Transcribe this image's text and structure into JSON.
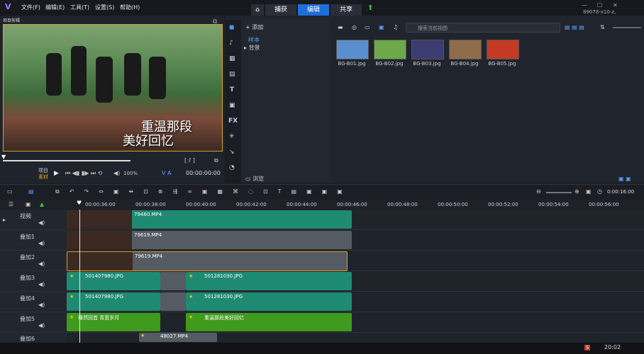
{
  "app": {
    "logo": "V",
    "status": "89078-x10-z, 1920*1080"
  },
  "menu": [
    "文件(F)",
    "编辑(E)",
    "工具(T)",
    "设置(S)",
    "帮助(H)"
  ],
  "tabs": [
    {
      "label": "⌂"
    },
    {
      "label": "捕获"
    },
    {
      "label": "编辑"
    },
    {
      "label": "共享"
    }
  ],
  "preview": {
    "corner_label": "项目剪辑",
    "caption_line1": "重温那段",
    "caption_line2": "美好回忆",
    "mode_project": "项目",
    "mode_clip": "素材",
    "timecode": "00:00:00:00",
    "zoom": "100%"
  },
  "library": {
    "add_label": "添加",
    "tree": [
      "样本",
      "背景"
    ],
    "search_placeholder": "搜索当前视图",
    "browse_label": "浏览",
    "thumbs": [
      {
        "name": "BG-B01.jpg",
        "color": "#5a8fcf"
      },
      {
        "name": "BG-B02.jpg",
        "color": "#6da94a"
      },
      {
        "name": "BG-B03.jpg",
        "color": "#3b3d70"
      },
      {
        "name": "BG-B04.jpg",
        "color": "#8f6d4b"
      },
      {
        "name": "BG-B05.jpg",
        "color": "#c43a24"
      }
    ]
  },
  "timeline": {
    "ruler": [
      "00:00:36:00",
      "00:00:38:00",
      "00:00:40:00",
      "00:00:42:00",
      "00:00:44:00",
      "00:00:46:00",
      "00:00:48:00",
      "00:00:50:00",
      "00:00:52:00",
      "00:00:54:00",
      "00:00:56:00"
    ],
    "zoom_time": "0:00:16:00",
    "tracks": [
      {
        "name": "视频"
      },
      {
        "name": "叠加1"
      },
      {
        "name": "叠加2"
      },
      {
        "name": "叠加3"
      },
      {
        "name": "叠加4"
      },
      {
        "name": "叠加5"
      },
      {
        "name": "叠加6"
      }
    ],
    "clips": {
      "v1": "79460.MP4",
      "o1": "79619.MP4",
      "o2": "79619.MP4",
      "o3a": "501407980.JPG",
      "o3b": "501281030.JPG",
      "o4a": "501407980.JPG",
      "o4b": "501281030.JPG",
      "o5a": "蓦然回首  青葱岁月",
      "o5b": "重温那段美好回忆",
      "o6": "48027.MP4"
    }
  },
  "taskbar": {
    "time": "20:02"
  }
}
